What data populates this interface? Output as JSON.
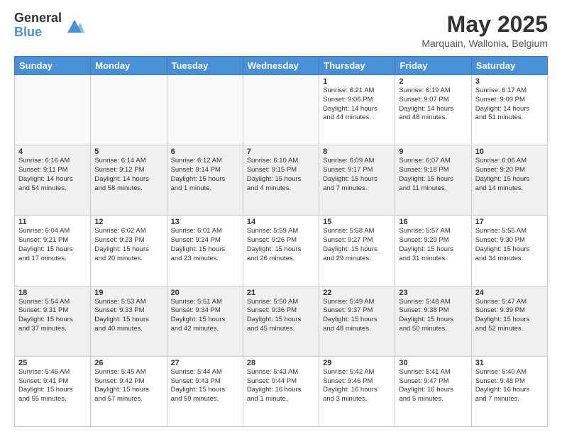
{
  "logo": {
    "general": "General",
    "blue": "Blue"
  },
  "header": {
    "month_year": "May 2025",
    "location": "Marquain, Wallonia, Belgium"
  },
  "weekdays": [
    "Sunday",
    "Monday",
    "Tuesday",
    "Wednesday",
    "Thursday",
    "Friday",
    "Saturday"
  ],
  "weeks": [
    [
      {
        "day": "",
        "info": "",
        "empty": true
      },
      {
        "day": "",
        "info": "",
        "empty": true
      },
      {
        "day": "",
        "info": "",
        "empty": true
      },
      {
        "day": "",
        "info": "",
        "empty": true
      },
      {
        "day": "1",
        "info": "Sunrise: 6:21 AM\nSunset: 9:06 PM\nDaylight: 14 hours\nand 44 minutes."
      },
      {
        "day": "2",
        "info": "Sunrise: 6:19 AM\nSunset: 9:07 PM\nDaylight: 14 hours\nand 48 minutes."
      },
      {
        "day": "3",
        "info": "Sunrise: 6:17 AM\nSunset: 9:09 PM\nDaylight: 14 hours\nand 51 minutes."
      }
    ],
    [
      {
        "day": "4",
        "info": "Sunrise: 6:16 AM\nSunset: 9:11 PM\nDaylight: 14 hours\nand 54 minutes.",
        "shaded": true
      },
      {
        "day": "5",
        "info": "Sunrise: 6:14 AM\nSunset: 9:12 PM\nDaylight: 14 hours\nand 58 minutes.",
        "shaded": true
      },
      {
        "day": "6",
        "info": "Sunrise: 6:12 AM\nSunset: 9:14 PM\nDaylight: 15 hours\nand 1 minute.",
        "shaded": true
      },
      {
        "day": "7",
        "info": "Sunrise: 6:10 AM\nSunset: 9:15 PM\nDaylight: 15 hours\nand 4 minutes.",
        "shaded": true
      },
      {
        "day": "8",
        "info": "Sunrise: 6:09 AM\nSunset: 9:17 PM\nDaylight: 15 hours\nand 7 minutes.",
        "shaded": true
      },
      {
        "day": "9",
        "info": "Sunrise: 6:07 AM\nSunset: 9:18 PM\nDaylight: 15 hours\nand 11 minutes.",
        "shaded": true
      },
      {
        "day": "10",
        "info": "Sunrise: 6:06 AM\nSunset: 9:20 PM\nDaylight: 15 hours\nand 14 minutes.",
        "shaded": true
      }
    ],
    [
      {
        "day": "11",
        "info": "Sunrise: 6:04 AM\nSunset: 9:21 PM\nDaylight: 15 hours\nand 17 minutes."
      },
      {
        "day": "12",
        "info": "Sunrise: 6:02 AM\nSunset: 9:23 PM\nDaylight: 15 hours\nand 20 minutes."
      },
      {
        "day": "13",
        "info": "Sunrise: 6:01 AM\nSunset: 9:24 PM\nDaylight: 15 hours\nand 23 minutes."
      },
      {
        "day": "14",
        "info": "Sunrise: 5:59 AM\nSunset: 9:26 PM\nDaylight: 15 hours\nand 26 minutes."
      },
      {
        "day": "15",
        "info": "Sunrise: 5:58 AM\nSunset: 9:27 PM\nDaylight: 15 hours\nand 29 minutes."
      },
      {
        "day": "16",
        "info": "Sunrise: 5:57 AM\nSunset: 9:29 PM\nDaylight: 15 hours\nand 31 minutes."
      },
      {
        "day": "17",
        "info": "Sunrise: 5:55 AM\nSunset: 9:30 PM\nDaylight: 15 hours\nand 34 minutes."
      }
    ],
    [
      {
        "day": "18",
        "info": "Sunrise: 5:54 AM\nSunset: 9:31 PM\nDaylight: 15 hours\nand 37 minutes.",
        "shaded": true
      },
      {
        "day": "19",
        "info": "Sunrise: 5:53 AM\nSunset: 9:33 PM\nDaylight: 15 hours\nand 40 minutes.",
        "shaded": true
      },
      {
        "day": "20",
        "info": "Sunrise: 5:51 AM\nSunset: 9:34 PM\nDaylight: 15 hours\nand 42 minutes.",
        "shaded": true
      },
      {
        "day": "21",
        "info": "Sunrise: 5:50 AM\nSunset: 9:36 PM\nDaylight: 15 hours\nand 45 minutes.",
        "shaded": true
      },
      {
        "day": "22",
        "info": "Sunrise: 5:49 AM\nSunset: 9:37 PM\nDaylight: 15 hours\nand 48 minutes.",
        "shaded": true
      },
      {
        "day": "23",
        "info": "Sunrise: 5:48 AM\nSunset: 9:38 PM\nDaylight: 15 hours\nand 50 minutes.",
        "shaded": true
      },
      {
        "day": "24",
        "info": "Sunrise: 5:47 AM\nSunset: 9:39 PM\nDaylight: 15 hours\nand 52 minutes.",
        "shaded": true
      }
    ],
    [
      {
        "day": "25",
        "info": "Sunrise: 5:46 AM\nSunset: 9:41 PM\nDaylight: 15 hours\nand 55 minutes."
      },
      {
        "day": "26",
        "info": "Sunrise: 5:45 AM\nSunset: 9:42 PM\nDaylight: 15 hours\nand 57 minutes."
      },
      {
        "day": "27",
        "info": "Sunrise: 5:44 AM\nSunset: 9:43 PM\nDaylight: 15 hours\nand 59 minutes."
      },
      {
        "day": "28",
        "info": "Sunrise: 5:43 AM\nSunset: 9:44 PM\nDaylight: 16 hours\nand 1 minute."
      },
      {
        "day": "29",
        "info": "Sunrise: 5:42 AM\nSunset: 9:46 PM\nDaylight: 16 hours\nand 3 minutes."
      },
      {
        "day": "30",
        "info": "Sunrise: 5:41 AM\nSunset: 9:47 PM\nDaylight: 16 hours\nand 5 minutes."
      },
      {
        "day": "31",
        "info": "Sunrise: 5:40 AM\nSunset: 9:48 PM\nDaylight: 16 hours\nand 7 minutes."
      }
    ]
  ]
}
